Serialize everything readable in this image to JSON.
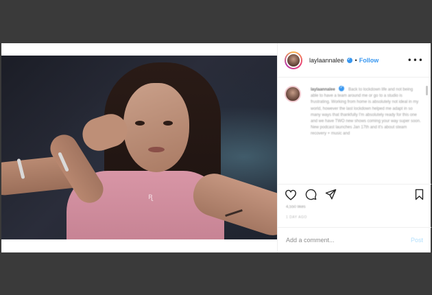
{
  "post": {
    "username": "laylaannalee",
    "follow_label": "Follow",
    "separator": "•",
    "more_label": "•••",
    "photo_logo": "ꭆ",
    "caption_username": "laylaannalee",
    "caption_text": "Back to lockdown life and not being able to have a team around me or go to a studio is frustrating. Working from home is absolutely not ideal in my world, however the last lockdown helped me adapt in so many ways that thankfully I'm absolutely ready for this one and we have TWO new shows coming your way super soon. New podcast launches Jan 17th and it's",
    "caption_more": "about steam recovery + music and",
    "likes": "4,550 likes",
    "date": "1 DAY AGO",
    "comment_placeholder": "Add a comment...",
    "post_label": "Post"
  },
  "icons": {
    "verified": "verified-badge-icon",
    "like": "heart-icon",
    "comment": "comment-icon",
    "share": "paper-plane-icon",
    "save": "bookmark-icon",
    "more": "more-options-icon"
  },
  "colors": {
    "accent": "#3897f0",
    "post_disabled": "#b2dffc",
    "backdrop": "#3a3a3a"
  }
}
